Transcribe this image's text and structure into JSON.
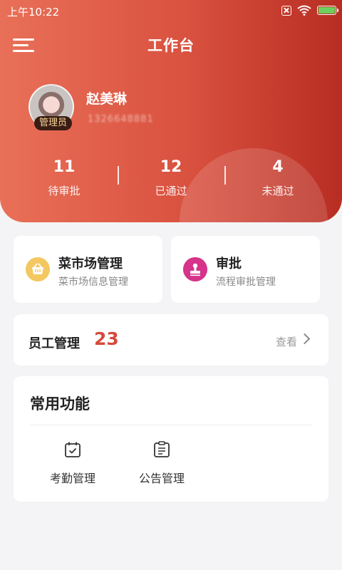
{
  "status_bar": {
    "time": "上午10:22",
    "icons": [
      "sim-icon",
      "wifi-icon",
      "battery-icon"
    ]
  },
  "header": {
    "title": "工作台",
    "menu_icon": "menu-icon"
  },
  "profile": {
    "name": "赵美琳",
    "phone": "1326648881",
    "role": "管理员"
  },
  "stats": [
    {
      "value": "11",
      "label": "待审批"
    },
    {
      "value": "12",
      "label": "已通过"
    },
    {
      "value": "4",
      "label": "未通过"
    }
  ],
  "quick_actions": [
    {
      "title": "菜市场管理",
      "subtitle": "菜市场信息管理",
      "icon": "basket-icon",
      "color": "#f3c861"
    },
    {
      "title": "审批",
      "subtitle": "流程审批管理",
      "icon": "stamp-icon",
      "color": "#d6338a"
    }
  ],
  "staff": {
    "label": "员工管理",
    "count": "23",
    "view_label": "查看"
  },
  "common_functions": {
    "title": "常用功能",
    "items": [
      {
        "label": "考勤管理",
        "icon": "calendar-check-icon"
      },
      {
        "label": "公告管理",
        "icon": "clipboard-icon"
      }
    ]
  },
  "colors": {
    "primary": "#d64a3c",
    "gradient_start": "#e97058",
    "gradient_end": "#b82d22",
    "background": "#f4f4f6"
  }
}
